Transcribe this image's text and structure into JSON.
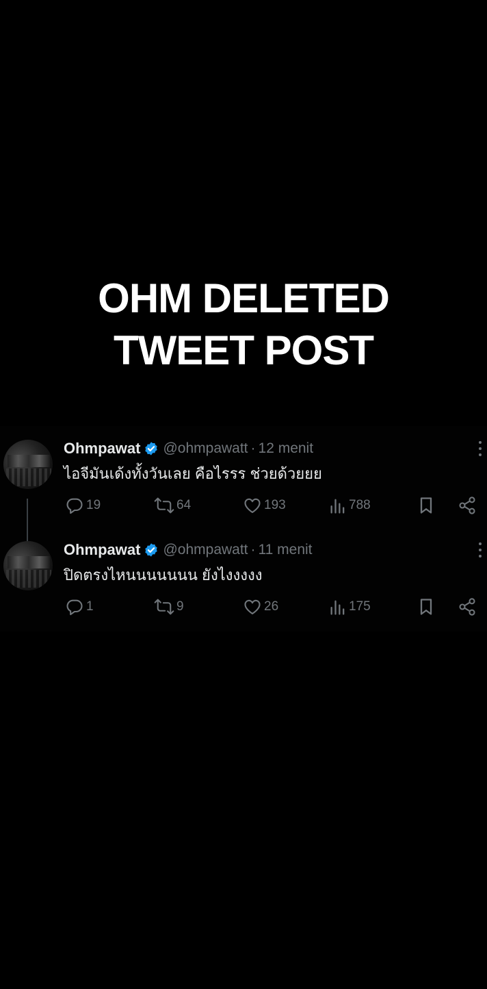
{
  "overlay": {
    "line1": "OHM DELETED",
    "line2": "TWEET POST"
  },
  "colors": {
    "background": "#000000",
    "text": "#e7e9ea",
    "muted": "#71767b",
    "verified": "#1d9bf0"
  },
  "tweets": [
    {
      "display_name": "Ohmpawat",
      "handle": "@ohmpawatt",
      "dot": "·",
      "time": "12 menit",
      "text": "ไอจีมันเด้งทั้งวันเลย คือไรรร ช่วยด้วยยย",
      "replies": "19",
      "retweets": "64",
      "likes": "193",
      "views": "788",
      "icons": [
        "avatar",
        "verified-badge-icon",
        "more-icon",
        "reply-icon",
        "retweet-icon",
        "like-icon",
        "views-icon",
        "bookmark-icon",
        "share-icon"
      ]
    },
    {
      "display_name": "Ohmpawat",
      "handle": "@ohmpawatt",
      "dot": "·",
      "time": "11 menit",
      "text": "ปิดตรงไหนนนนนนน ยังไงงงงง",
      "replies": "1",
      "retweets": "9",
      "likes": "26",
      "views": "175",
      "icons": [
        "avatar",
        "verified-badge-icon",
        "more-icon",
        "reply-icon",
        "retweet-icon",
        "like-icon",
        "views-icon",
        "bookmark-icon",
        "share-icon"
      ]
    }
  ]
}
